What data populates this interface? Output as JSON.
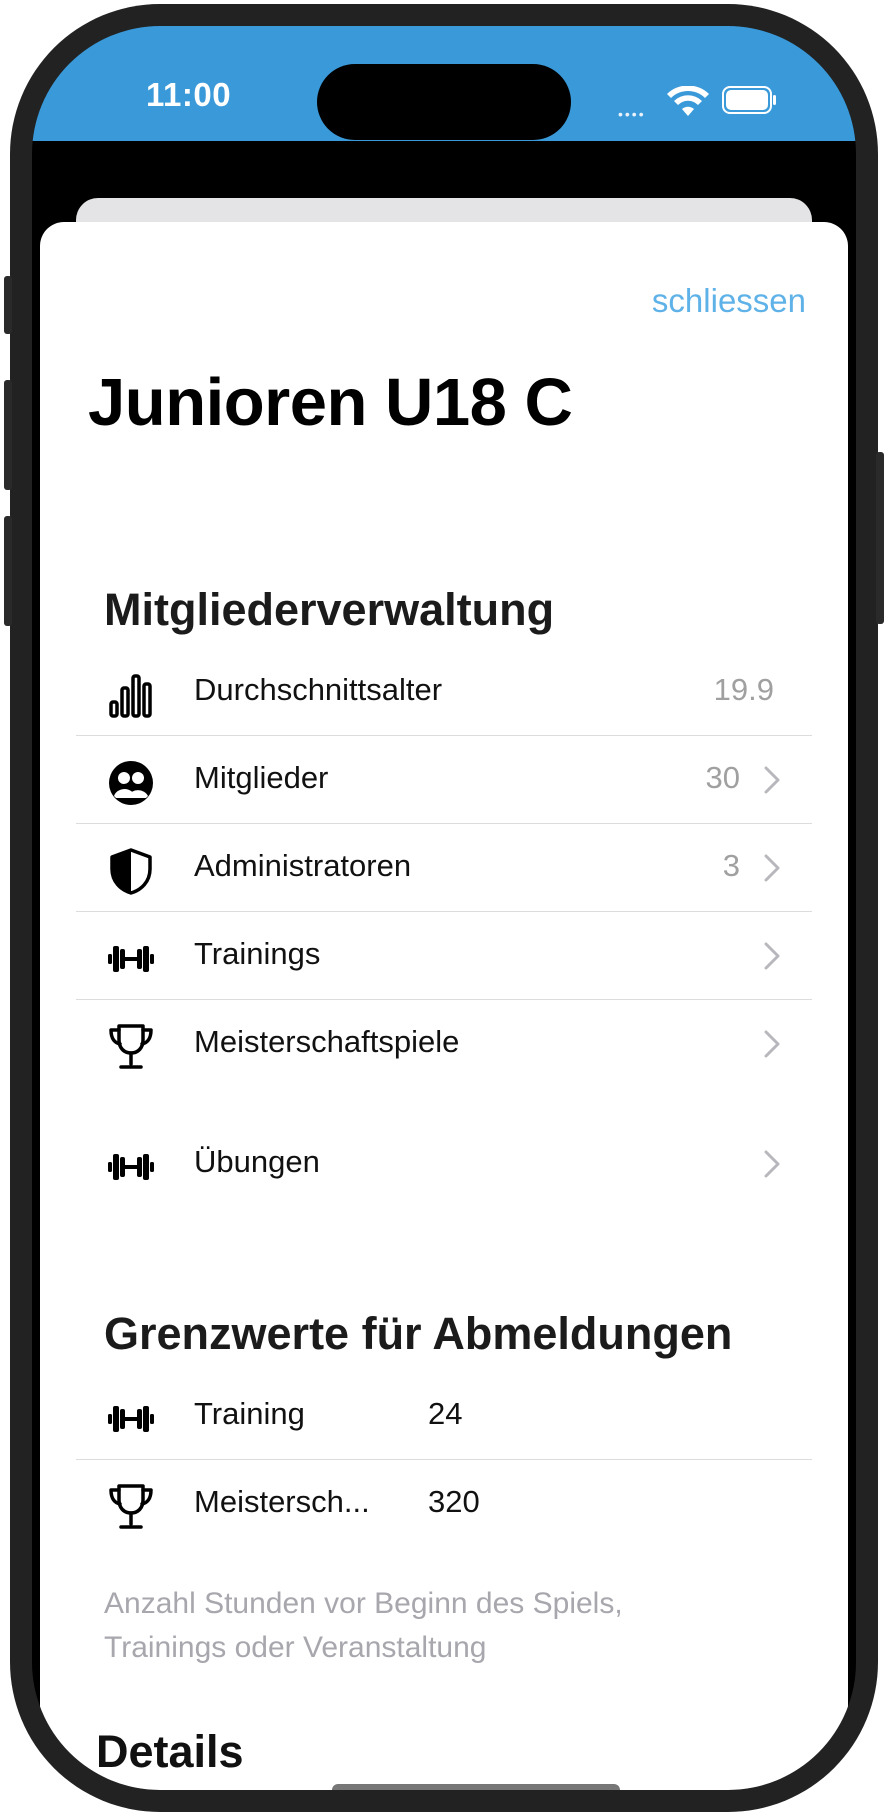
{
  "status": {
    "time": "11:00"
  },
  "sheet": {
    "close_label": "schliessen",
    "title": "Junioren U18 C"
  },
  "sections": {
    "members": {
      "title": "Mitgliederverwaltung",
      "rows": [
        {
          "label": "Durchschnittsalter",
          "value": "19.9",
          "icon": "bar-chart-icon"
        },
        {
          "label": "Mitglieder",
          "value": "30",
          "icon": "people-icon"
        },
        {
          "label": "Administratoren",
          "value": "3",
          "icon": "shield-icon"
        },
        {
          "label": "Trainings",
          "value": "",
          "icon": "dumbbell-icon"
        },
        {
          "label": "Meisterschaftspiele",
          "value": "",
          "icon": "trophy-icon"
        },
        {
          "label": "Übungen",
          "value": "",
          "icon": "dumbbell-icon"
        }
      ]
    },
    "limits": {
      "title": "Grenzwerte für Abmeldungen",
      "rows": [
        {
          "label": "Training",
          "value": "24",
          "icon": "dumbbell-icon"
        },
        {
          "label": "Meistersch...",
          "value": "320",
          "icon": "trophy-icon"
        }
      ],
      "footnote": "Anzahl Stunden vor Beginn des Spiels, Trainings oder Veranstaltung"
    },
    "details": {
      "title": "Details"
    }
  },
  "colors": {
    "statusbar": "#3a9ad9",
    "link": "#5fb2e8",
    "secondary_text": "#a0a0a0",
    "divider": "#dcdcdc"
  }
}
